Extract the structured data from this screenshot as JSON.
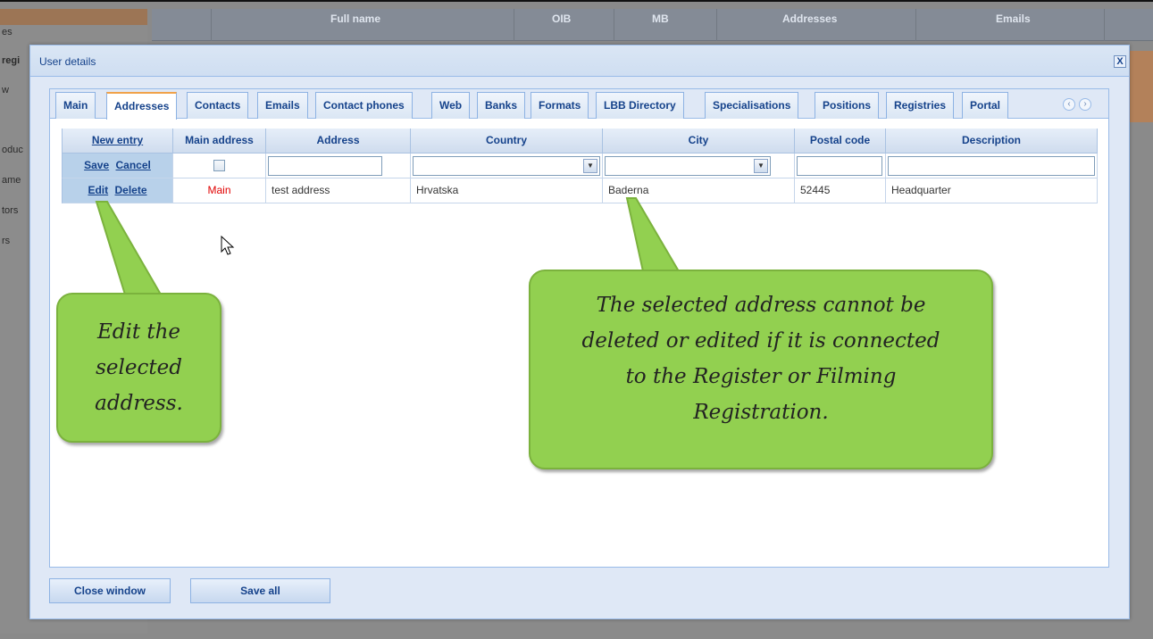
{
  "background": {
    "left_items": [
      "es",
      "regi",
      "w",
      "oduc",
      "ame",
      "tors",
      "rs"
    ],
    "grid_columns": [
      "Full name",
      "OIB",
      "MB",
      "Addresses",
      "Emails"
    ]
  },
  "dialog": {
    "title": "User details",
    "close_label": "X",
    "tabs": [
      "Main",
      "Addresses",
      "Contacts",
      "Emails",
      "Contact phones",
      "Web",
      "Banks",
      "Formats",
      "LBB Directory",
      "Specialisations",
      "Positions",
      "Registries",
      "Portal"
    ],
    "active_tab": "Addresses",
    "tab_scroll_left": "‹",
    "tab_scroll_right": "›"
  },
  "grid": {
    "columns": [
      "New entry",
      "Main address",
      "Address",
      "Country",
      "City",
      "Postal code",
      "Description"
    ],
    "edit_row": {
      "save": "Save",
      "cancel": "Cancel"
    },
    "rows": [
      {
        "edit": "Edit",
        "delete": "Delete",
        "main": "Main",
        "address": "test address",
        "country": "Hrvatska",
        "city": "Baderna",
        "postal_code": "52445",
        "description": "Headquarter"
      }
    ]
  },
  "buttons": {
    "close_window": "Close window",
    "save_all": "Save all"
  },
  "callouts": {
    "edit": [
      "Edit the",
      "selected",
      "address."
    ],
    "warning": [
      "The selected address cannot be",
      "deleted or edited if it is connected",
      "to the Register or Filming",
      "Registration."
    ]
  },
  "colors": {
    "callout_fill": "#92d050",
    "dialog_header": "#dae6f4",
    "active_tab_accent": "#f0a24a",
    "main_label": "#e00000"
  }
}
